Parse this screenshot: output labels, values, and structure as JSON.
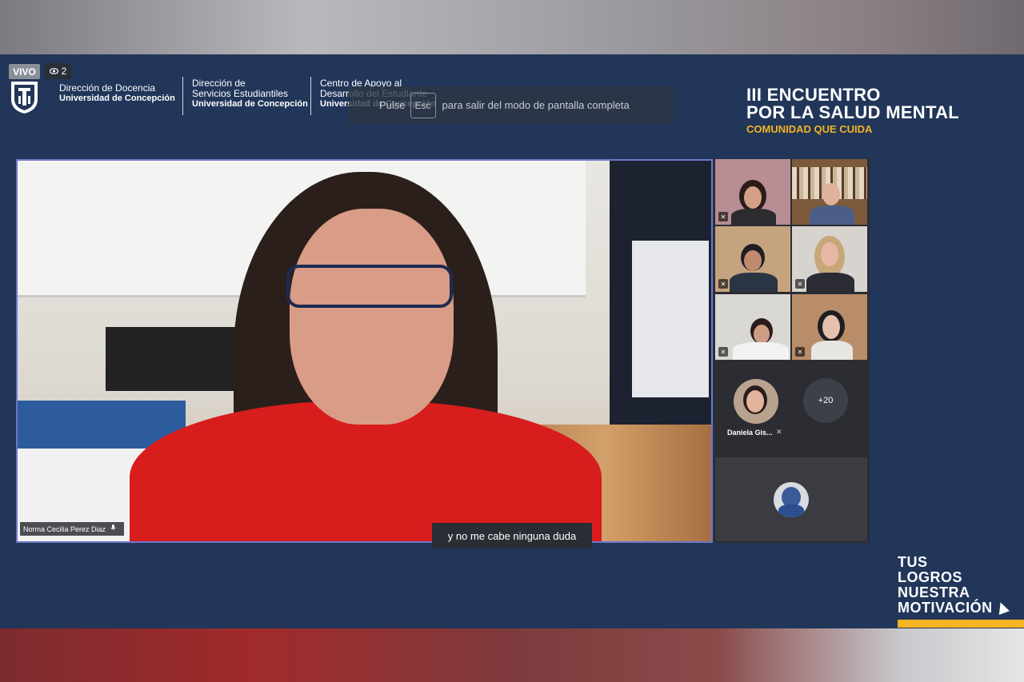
{
  "live": {
    "badge_label": "VIVO",
    "viewer_icon": "eye-icon",
    "viewer_count": "2"
  },
  "organizations": [
    {
      "line1": "Dirección de Docencia",
      "line2": "",
      "sub": "Universidad de Concepción"
    },
    {
      "line1": "Dirección de",
      "line2": "Servicios Estudiantiles",
      "sub": "Universidad de Concepción"
    },
    {
      "line1": "Centro de Apoyo al",
      "line2": "Desarrollo del Estudiante",
      "sub": "Universidad de Concepción"
    }
  ],
  "fullscreen_notice": {
    "prefix": "Pulse",
    "key": "Esc",
    "text": "para salir del modo de pantalla completa"
  },
  "event": {
    "title_line1": "III ENCUENTRO",
    "title_line2": "POR LA SALUD MENTAL",
    "subtitle": "COMUNIDAD QUE CUIDA"
  },
  "main_speaker": {
    "name": "Norma Cecilia Perez Diaz",
    "caption": "y no me cabe ninguna duda"
  },
  "participants": {
    "tiles": [
      {
        "name": "participant-1",
        "muted": true
      },
      {
        "name": "participant-2",
        "muted": false
      },
      {
        "name": "participant-3",
        "muted": true
      },
      {
        "name": "participant-4",
        "muted": true
      },
      {
        "name": "participant-5",
        "muted": true
      },
      {
        "name": "participant-6",
        "muted": true
      }
    ],
    "avatar_name": "Daniela Gis...",
    "more_count": "+20"
  },
  "slogan": {
    "line1": "TUS",
    "line2": "LOGROS",
    "line3": "NUESTRA",
    "line4": "MOTIVACIÓN"
  },
  "colors": {
    "stage_bg": "#213659",
    "accent_yellow": "#f6b324",
    "active_border": "#6e77c8"
  }
}
